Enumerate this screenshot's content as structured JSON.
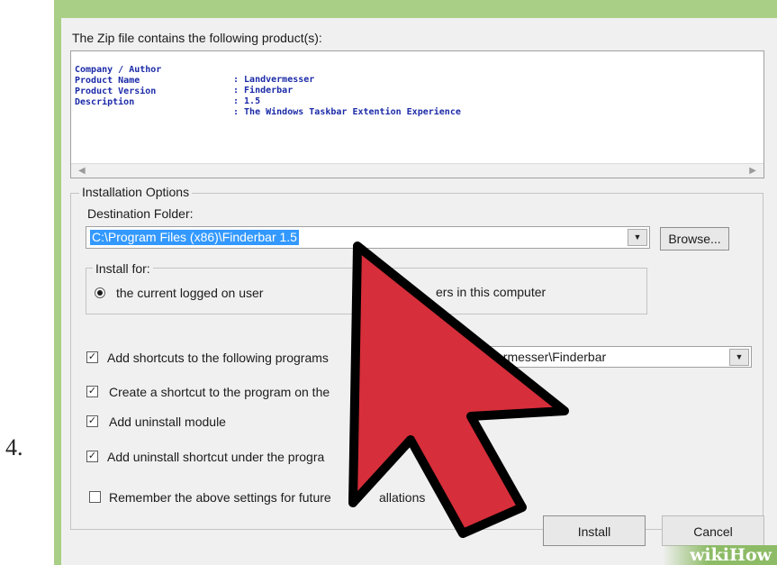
{
  "step_number": "4.",
  "header_label": "The Zip file contains the following product(s):",
  "product_info": [
    {
      "key": "Company / Author",
      "value": ": Landvermesser"
    },
    {
      "key": "Product Name",
      "value": ": Finderbar"
    },
    {
      "key": "Product Version",
      "value": ": 1.5"
    },
    {
      "key": "Description",
      "value": ": The Windows Taskbar Extention Experience"
    }
  ],
  "installation_options": {
    "title": "Installation Options",
    "destination_label": "Destination Folder:",
    "destination_value": "C:\\Program Files (x86)\\Finderbar 1.5",
    "browse_label": "Browse...",
    "install_for_title": "Install for:",
    "radio_current_user": "the current logged on user",
    "radio_all_users_partial": "ers in this computer"
  },
  "options": [
    {
      "label": "Add shortcuts to the following programs",
      "checked": true
    },
    {
      "label": "Create a shortcut to the program on the",
      "checked": true
    },
    {
      "label": "Add uninstall module",
      "checked": true
    },
    {
      "label": "Add uninstall shortcut under the progra",
      "checked": true
    }
  ],
  "shortcut_folder_partial": "ermesser\\Finderbar",
  "remember_label_left": "Remember the above settings for future",
  "remember_label_right": "allations",
  "remember_checked": false,
  "install_label": "Install",
  "cancel_label": "Cancel",
  "watermark": "wikiHow",
  "colors": {
    "frame": "#a9cf86",
    "dialog": "#f0f0f0",
    "info_text": "#1b2aa8",
    "selection": "#3399ff",
    "cursor_fill": "#d62e3a",
    "cursor_outline": "#000000"
  },
  "icons": {
    "combo_arrow": "chevron-down-icon",
    "scroll_left": "arrow-left-icon",
    "scroll_right": "arrow-right-icon",
    "pointer": "mouse-cursor-icon"
  }
}
